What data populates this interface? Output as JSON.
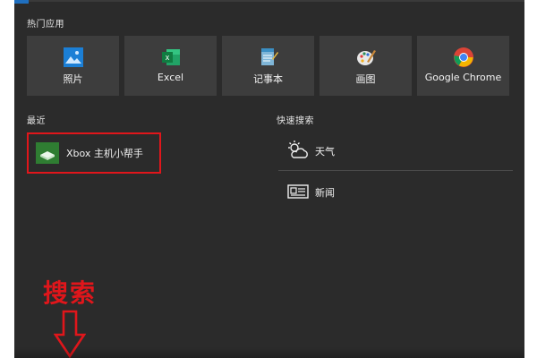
{
  "colors": {
    "panel_bg": "#2b2b2b",
    "tile_bg": "#3d3d3d",
    "accent_blue": "#1f6fbf",
    "annotation_red": "#e0161b"
  },
  "sections": {
    "popular_apps_title": "热门应用",
    "recent_title": "最近",
    "quick_search_title": "快速搜索"
  },
  "popular_apps": [
    {
      "label": "照片",
      "icon": "photos-icon"
    },
    {
      "label": "Excel",
      "icon": "excel-icon"
    },
    {
      "label": "记事本",
      "icon": "notepad-icon"
    },
    {
      "label": "画图",
      "icon": "paint-icon"
    },
    {
      "label": "Google Chrome",
      "icon": "chrome-icon"
    }
  ],
  "recent": [
    {
      "label": "Xbox 主机小帮手",
      "icon": "xbox-icon"
    }
  ],
  "quick_search": [
    {
      "label": "天气",
      "icon": "weather-icon"
    },
    {
      "label": "新闻",
      "icon": "news-icon"
    }
  ],
  "annotation": {
    "text": "搜索",
    "icon": "down-arrow-icon"
  }
}
